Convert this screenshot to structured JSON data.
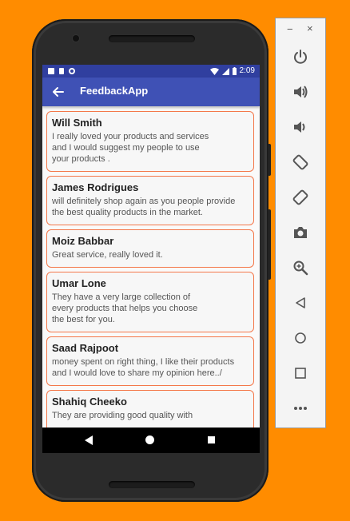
{
  "status_bar": {
    "time": "2:09"
  },
  "app_bar": {
    "title": "FeedbackApp",
    "back_icon": "arrow-back-icon"
  },
  "feedback": [
    {
      "name": "Will Smith",
      "text": "I really loved your products and services\nand I would suggest my people to use\nyour products ."
    },
    {
      "name": "James Rodrigues",
      "text": "will definitely shop again as you people provide\nthe best quality products in the market."
    },
    {
      "name": "Moiz Babbar",
      "text": "Great service, really loved it."
    },
    {
      "name": "Umar Lone",
      "text": "They have a very large collection of\nevery products that helps you choose\nthe best for you."
    },
    {
      "name": "Saad Rajpoot",
      "text": "money spent on right thing, I like their products\nand I would love to share my opinion here../"
    },
    {
      "name": "Shahiq Cheeko",
      "text": "They are providing good quality with"
    }
  ],
  "nav_bar": {
    "back_icon": "triangle-back-icon",
    "home_icon": "circle-home-icon",
    "recents_icon": "square-recents-icon"
  },
  "emulator_panel": {
    "minimize": "−",
    "close": "×",
    "tools": [
      "power-icon",
      "volume-up-icon",
      "volume-down-icon",
      "rotate-left-icon",
      "rotate-right-icon",
      "camera-icon",
      "zoom-icon",
      "back-icon",
      "home-icon",
      "overview-icon",
      "more-icon"
    ]
  },
  "colors": {
    "background": "#FF8C00",
    "app_bar": "#3F51B5",
    "status_bar": "#303F9F",
    "card_border": "#F4784A"
  }
}
